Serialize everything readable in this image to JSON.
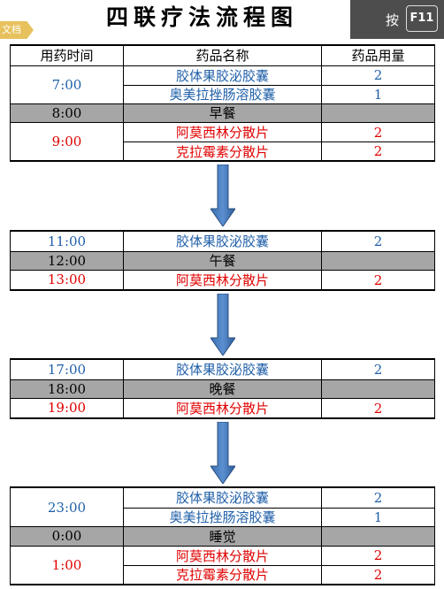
{
  "title": "四联疗法流程图",
  "tab_label": "文档",
  "hint": {
    "text": "按",
    "key": "F11"
  },
  "header": {
    "time": "用药时间",
    "name": "药品名称",
    "qty": "药品用量"
  },
  "blocks": [
    {
      "groups": [
        {
          "time": "7:00",
          "color": "blue",
          "meds": [
            {
              "name": "胶体果胶泌胶囊",
              "qty": "2"
            },
            {
              "name": "奥美拉挫肠溶胶囊",
              "qty": "1"
            }
          ]
        },
        {
          "meal": true,
          "time": "8:00",
          "label": "早餐"
        },
        {
          "time": "9:00",
          "color": "red",
          "meds": [
            {
              "name": "阿莫西林分散片",
              "qty": "2"
            },
            {
              "name": "克拉霉素分散片",
              "qty": "2"
            }
          ]
        }
      ]
    },
    {
      "groups": [
        {
          "time": "11:00",
          "color": "blue",
          "meds": [
            {
              "name": "胶体果胶泌胶囊",
              "qty": "2"
            }
          ]
        },
        {
          "meal": true,
          "time": "12:00",
          "label": "午餐"
        },
        {
          "time": "13:00",
          "color": "red",
          "meds": [
            {
              "name": "阿莫西林分散片",
              "qty": "2"
            }
          ]
        }
      ]
    },
    {
      "groups": [
        {
          "time": "17:00",
          "color": "blue",
          "meds": [
            {
              "name": "胶体果胶泌胶囊",
              "qty": "2"
            }
          ]
        },
        {
          "meal": true,
          "time": "18:00",
          "label": "晚餐"
        },
        {
          "time": "19:00",
          "color": "red",
          "meds": [
            {
              "name": "阿莫西林分散片",
              "qty": "2"
            }
          ]
        }
      ]
    },
    {
      "groups": [
        {
          "time": "23:00",
          "color": "blue",
          "meds": [
            {
              "name": "胶体果胶泌胶囊",
              "qty": "2"
            },
            {
              "name": "奥美拉挫肠溶胶囊",
              "qty": "1"
            }
          ]
        },
        {
          "meal": true,
          "time": "0:00",
          "label": "睡觉"
        },
        {
          "time": "1:00",
          "color": "red",
          "meds": [
            {
              "name": "阿莫西林分散片",
              "qty": "2"
            },
            {
              "name": "克拉霉素分散片",
              "qty": "2"
            }
          ]
        }
      ]
    }
  ]
}
